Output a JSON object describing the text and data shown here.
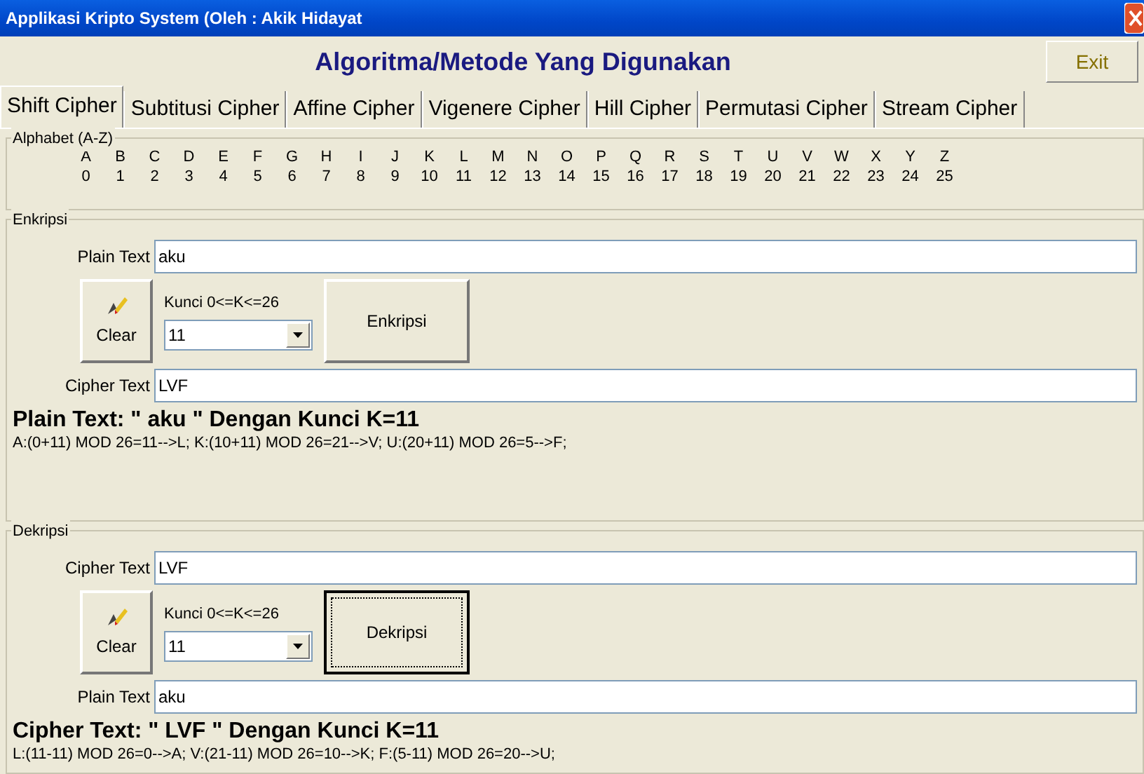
{
  "window": {
    "title": "Applikasi Kripto System (Oleh : Akik Hidayat"
  },
  "header": {
    "title": "Algoritma/Metode Yang Digunakan",
    "exit_button": "Exit"
  },
  "tabs": [
    {
      "label": "Shift Cipher",
      "selected": true
    },
    {
      "label": "Subtitusi Cipher",
      "selected": false
    },
    {
      "label": "Affine Cipher",
      "selected": false
    },
    {
      "label": "Vigenere Cipher",
      "selected": false
    },
    {
      "label": "Hill Cipher",
      "selected": false
    },
    {
      "label": "Permutasi Cipher",
      "selected": false
    },
    {
      "label": "Stream Cipher",
      "selected": false
    }
  ],
  "alphabet": {
    "legend": "Alphabet (A-Z)",
    "letters": [
      {
        "letter": "A",
        "index": "0"
      },
      {
        "letter": "B",
        "index": "1"
      },
      {
        "letter": "C",
        "index": "2"
      },
      {
        "letter": "D",
        "index": "3"
      },
      {
        "letter": "E",
        "index": "4"
      },
      {
        "letter": "F",
        "index": "5"
      },
      {
        "letter": "G",
        "index": "6"
      },
      {
        "letter": "H",
        "index": "7"
      },
      {
        "letter": "I",
        "index": "8"
      },
      {
        "letter": "J",
        "index": "9"
      },
      {
        "letter": "K",
        "index": "10"
      },
      {
        "letter": "L",
        "index": "11"
      },
      {
        "letter": "M",
        "index": "12"
      },
      {
        "letter": "N",
        "index": "13"
      },
      {
        "letter": "O",
        "index": "14"
      },
      {
        "letter": "P",
        "index": "15"
      },
      {
        "letter": "Q",
        "index": "16"
      },
      {
        "letter": "R",
        "index": "17"
      },
      {
        "letter": "S",
        "index": "18"
      },
      {
        "letter": "T",
        "index": "19"
      },
      {
        "letter": "U",
        "index": "20"
      },
      {
        "letter": "V",
        "index": "21"
      },
      {
        "letter": "W",
        "index": "22"
      },
      {
        "letter": "X",
        "index": "23"
      },
      {
        "letter": "Y",
        "index": "24"
      },
      {
        "letter": "Z",
        "index": "25"
      }
    ]
  },
  "sections": [
    {
      "legend": "Enkripsi",
      "input_label": "Plain Text",
      "input_value": "aku",
      "clear_button": "Clear",
      "key_label": "Kunci 0<=K<=26",
      "key_value": "11",
      "action_button": "Enkripsi",
      "focused": false,
      "output_label": "Cipher Text",
      "output_value": "LVF",
      "result_title": "Plain Text: \" aku \" Dengan Kunci K=11",
      "result_steps": "A:(0+11) MOD 26=11-->L; K:(10+11) MOD 26=21-->V; U:(20+11) MOD 26=5-->F;"
    },
    {
      "legend": "Dekripsi",
      "input_label": "Cipher Text",
      "input_value": "LVF",
      "clear_button": "Clear",
      "key_label": "Kunci 0<=K<=26",
      "key_value": "11",
      "action_button": "Dekripsi",
      "focused": true,
      "output_label": "Plain Text",
      "output_value": "aku",
      "result_title": "Cipher Text: \" LVF \" Dengan Kunci K=11",
      "result_steps": "L:(11-11) MOD 26=0-->A; V:(21-11) MOD 26=10-->K; F:(5-11) MOD 26=20-->U;"
    }
  ]
}
